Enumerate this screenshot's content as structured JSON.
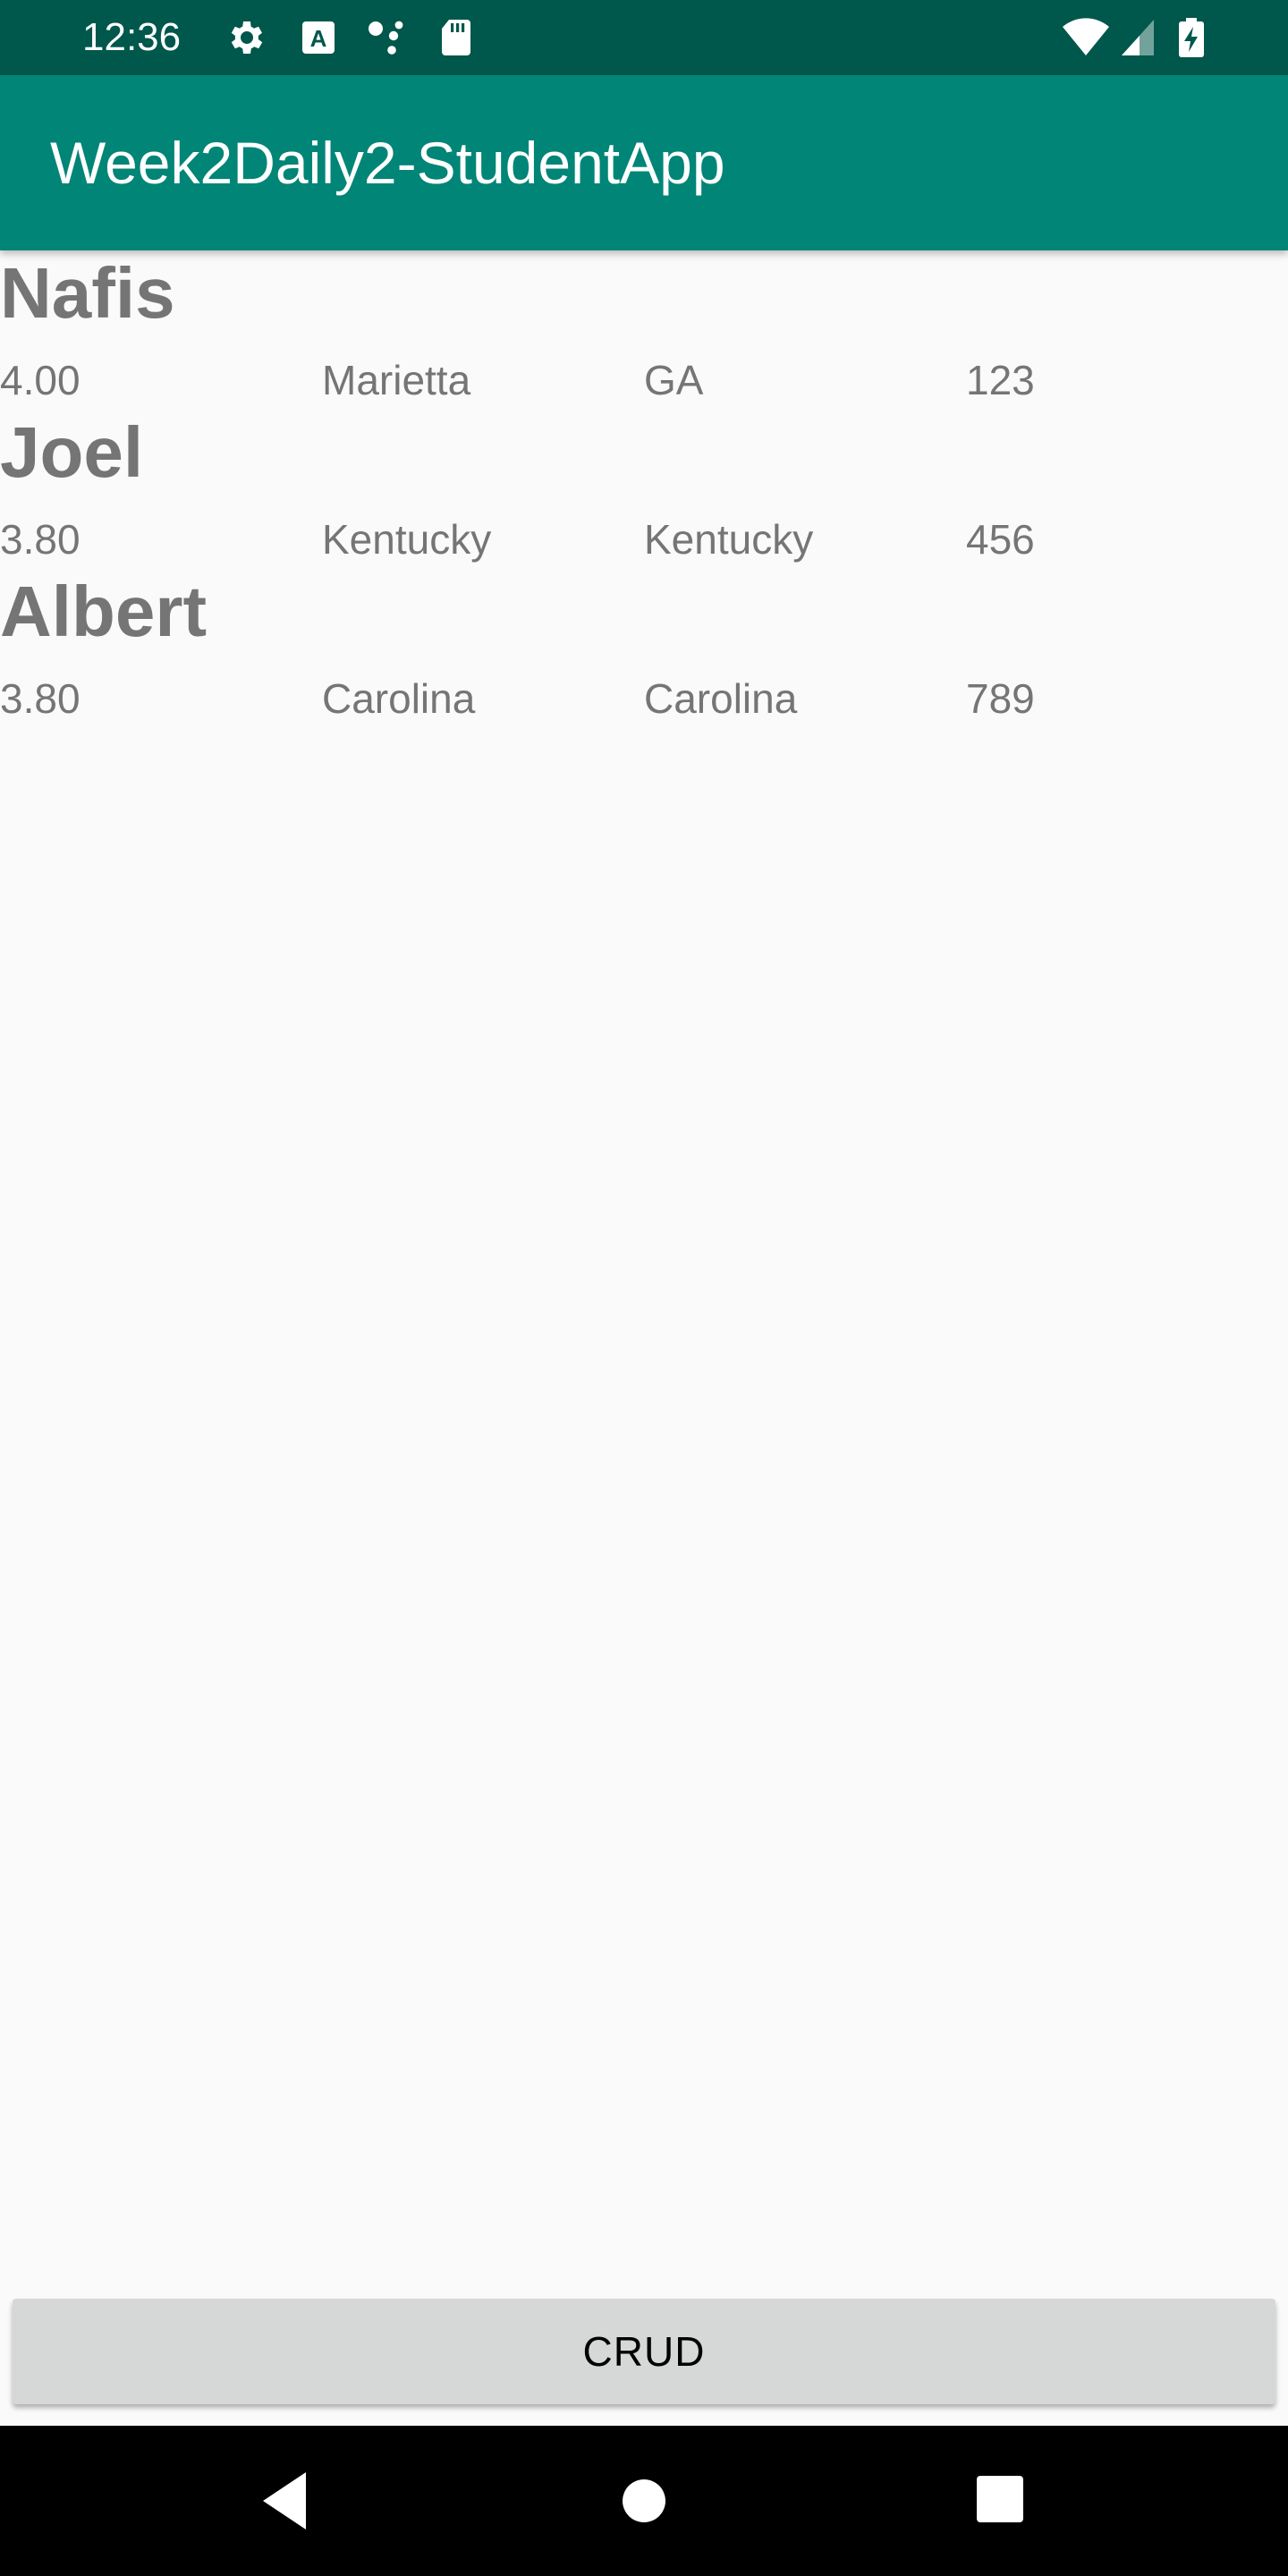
{
  "status_bar": {
    "time": "12:36",
    "left_icons": [
      "gear-icon",
      "font-a-icon",
      "share-icon",
      "sd-card-icon"
    ],
    "right_icons": [
      "wifi-icon",
      "signal-icon",
      "battery-charging-icon"
    ],
    "background": "#00574b"
  },
  "app_bar": {
    "title": "Week2Daily2-StudentApp",
    "background": "#008577"
  },
  "students": [
    {
      "name": "Nafis",
      "gpa": "4.00",
      "city": "Marietta",
      "state": "GA",
      "id": "123"
    },
    {
      "name": "Joel",
      "gpa": "3.80",
      "city": "Kentucky",
      "state": "Kentucky",
      "id": "456"
    },
    {
      "name": "Albert",
      "gpa": "3.80",
      "city": "Carolina",
      "state": "Carolina",
      "id": "789"
    }
  ],
  "crud_button": {
    "label": "CRUD"
  },
  "nav_bar": {
    "icons": [
      "back-icon",
      "home-icon",
      "recents-icon"
    ]
  }
}
